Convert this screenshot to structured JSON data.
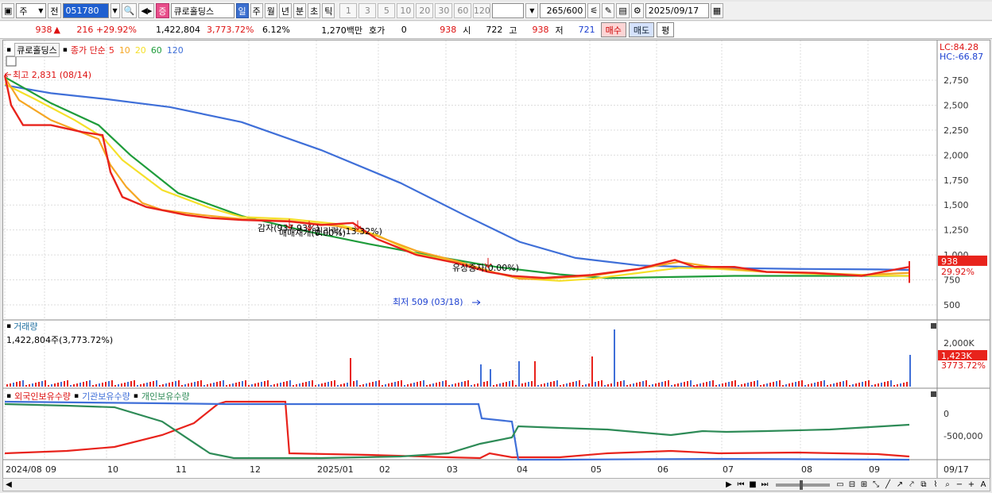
{
  "toolbar": {
    "period_label": "주",
    "prev_label": "전",
    "code": "051780",
    "badge": "증",
    "stock_name": "큐로홀딩스",
    "timeframes": [
      "일",
      "주",
      "월",
      "년",
      "분",
      "초",
      "틱"
    ],
    "active_timeframe": "일",
    "intervals": [
      "1",
      "3",
      "5",
      "10",
      "20",
      "30",
      "60",
      "120"
    ],
    "count_value": "265",
    "count_total": "/600",
    "date": "2025/09/17"
  },
  "infobar": {
    "price": "938",
    "change": "216",
    "change_pct": "+29.92%",
    "volume": "1,422,804",
    "volume_ratio": "3,773.72%",
    "turnover": "6.12%",
    "amount": "1,270백만",
    "quote_label": "호가",
    "quote_value": "0",
    "quote_price": "938",
    "open_label": "시",
    "open_value": "722",
    "high_label": "고",
    "high_value": "938",
    "low_label": "저",
    "low_value": "721",
    "buy_label": "매수",
    "sell_label": "매도",
    "eval_label": "평"
  },
  "price_panel": {
    "legend_name": "큐로홀딩스",
    "legend_ma_prefix": "종가 단순",
    "legend_ma": [
      {
        "label": "5",
        "color": "#e8231c"
      },
      {
        "label": "10",
        "color": "#f5a623"
      },
      {
        "label": "20",
        "color": "#f5e02a"
      },
      {
        "label": "60",
        "color": "#1f9c3b"
      },
      {
        "label": "120",
        "color": "#3f6fd8"
      }
    ],
    "lc": "LC:84.28",
    "hc": "HC:-66.87",
    "yticks": [
      "2,750",
      "2,500",
      "2,250",
      "2,000",
      "1,750",
      "1,500",
      "1,250",
      "1,000",
      "750",
      "500"
    ],
    "current_price_tag": "938",
    "current_pct_tag": "29.92%",
    "high_annotation": "최고 2,831 (08/14)",
    "low_annotation": "최저 509 (03/18)",
    "event_labels": [
      "감자(937.93%)",
      "매매재개(0.00%)",
      "권리락(-13.32%)",
      "유상증자(0.00%)"
    ]
  },
  "volume_panel": {
    "title": "거래량",
    "value": "1,422,804주(3,773.72%)",
    "ytick": "2,000K",
    "current_tag": "1,423K",
    "current_pct": "3773.72%"
  },
  "holding_panel": {
    "series": [
      "외국인보유수량",
      "기관보유수량",
      "개인보유수량"
    ],
    "series_colors": [
      "#e8231c",
      "#3f6fd8",
      "#2e8b57"
    ],
    "yticks": [
      "0",
      "-500,000"
    ]
  },
  "xaxis": {
    "labels": [
      "2024/08",
      "09",
      "10",
      "11",
      "12",
      "2025/01",
      "02",
      "03",
      "04",
      "05",
      "06",
      "07",
      "08",
      "09"
    ],
    "end_label": "09/17"
  }
}
